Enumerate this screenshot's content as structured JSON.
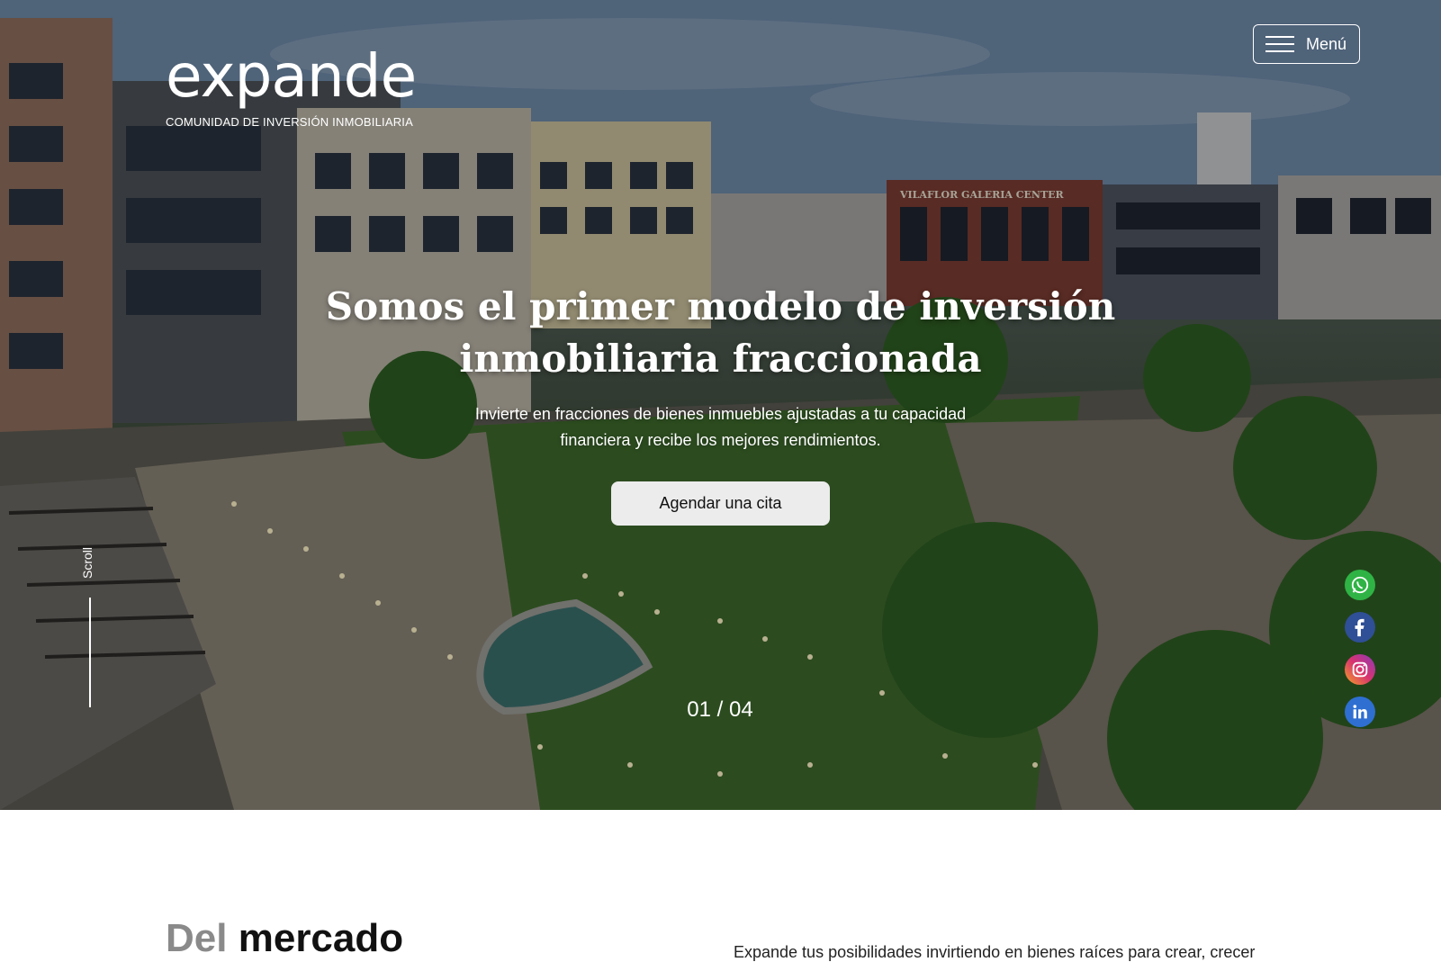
{
  "logo": {
    "word": "expande",
    "tagline": "COMUNIDAD DE INVERSIÓN INMOBILIARIA"
  },
  "menu": {
    "label": "Menú"
  },
  "hero": {
    "headline": "Somos el primer modelo de inversión inmobiliaria fraccionada",
    "subline": "Invierte en fracciones de bienes inmuebles ajustadas a tu capacidad financiera y recibe los mejores rendimientos.",
    "cta_label": "Agendar una cita",
    "scroll_label": "Scroll",
    "slide_counter": "01 / 04",
    "sign_text": "VILAFLOR   GALERIA   CENTER"
  },
  "social": [
    {
      "name": "whatsapp",
      "color": "#2fb345"
    },
    {
      "name": "facebook",
      "color": "#2f4f96"
    },
    {
      "name": "instagram",
      "color": "#d8336f"
    },
    {
      "name": "linkedin",
      "color": "#2e6fd1"
    }
  ],
  "section2": {
    "title_muted": "Del",
    "title_bold": "mercado",
    "intro": "Expande tus posibilidades invirtiendo en bienes raíces para crear, crecer"
  }
}
